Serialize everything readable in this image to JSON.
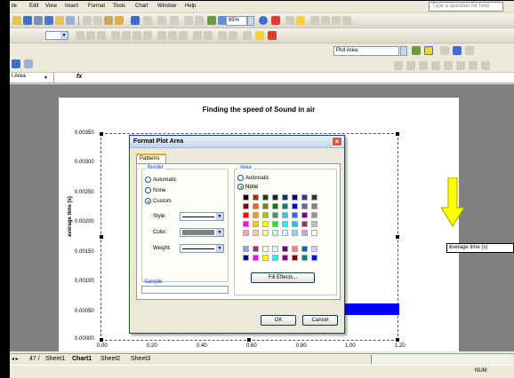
{
  "menu": {
    "items": [
      "ile",
      "Edit",
      "View",
      "Insert",
      "Format",
      "Tools",
      "Chart",
      "Window",
      "Help"
    ],
    "question_placeholder": "Type a question for help"
  },
  "toolbar": {
    "zoom": "85%",
    "chart_object": "Plot Area"
  },
  "formula_bar": {
    "name_box": "t Area",
    "fx": "fx"
  },
  "chart": {
    "title": "Finding the speed of Sound in air",
    "ylabel": "average time (s)",
    "yticks": [
      "0.00350",
      "0.00300",
      "0.00250",
      "0.00200",
      "0.00150",
      "0.00100",
      "0.00050",
      "0.00000"
    ],
    "xticks": [
      "0.00",
      "0.20",
      "0.40",
      "0.60",
      "0.80",
      "1.00",
      "1.20"
    ],
    "legend": "average time (s)",
    "arrow_color": "#ffff00"
  },
  "chart_data": {
    "type": "scatter",
    "title": "Finding the speed of Sound in air",
    "xlabel": "",
    "ylabel": "average time (s)",
    "xlim": [
      0,
      1.2
    ],
    "ylim": [
      0,
      0.0035
    ],
    "series": [
      {
        "name": "average time (s)",
        "x": [],
        "y": []
      }
    ],
    "legend_position": "right",
    "grid": false
  },
  "dialog": {
    "title": "Format Plot Area",
    "tab": "Patterns",
    "border": {
      "label": "Border",
      "options": [
        "Automatic",
        "None",
        "Custom"
      ],
      "selected": "Custom",
      "style_label": "Style:",
      "color_label": "Color:",
      "weight_label": "Weight:"
    },
    "area": {
      "label": "Area",
      "options": [
        "Automatic",
        "None"
      ],
      "selected": "None",
      "fill_effects": "Fill Effects..."
    },
    "sample_label": "Sample",
    "ok": "OK",
    "cancel": "Cancel"
  },
  "tabs": {
    "nav": "▸ ▸| 47 /",
    "sheets": [
      "Sheet1",
      "Chart1",
      "Sheet2",
      "Sheet3"
    ],
    "active": "Chart1"
  },
  "status": {
    "num": "NUM"
  }
}
